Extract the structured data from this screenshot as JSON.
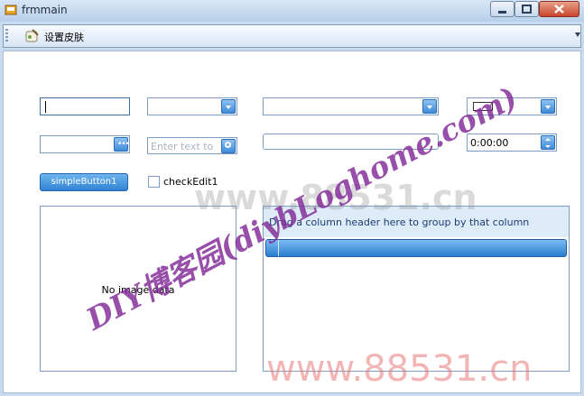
{
  "window": {
    "title": "frmmain"
  },
  "menu": {
    "item_label": "设置皮肤"
  },
  "controls": {
    "search_placeholder": "Enter text to",
    "time_value": "0:00:00",
    "simple_button_label": "simpleButton1",
    "check_label": "checkEdit1",
    "picture_text": "No image data",
    "grid_group_text": "Drag a column header here to group by that column"
  },
  "watermark": {
    "main": "DIY博客园(diybLoghome.com)",
    "faint": "www.88531.cn",
    "bottom": "www.88531.cn"
  },
  "colors": {
    "accent": "#3f8bd9",
    "watermark": "#8a2b9e"
  }
}
